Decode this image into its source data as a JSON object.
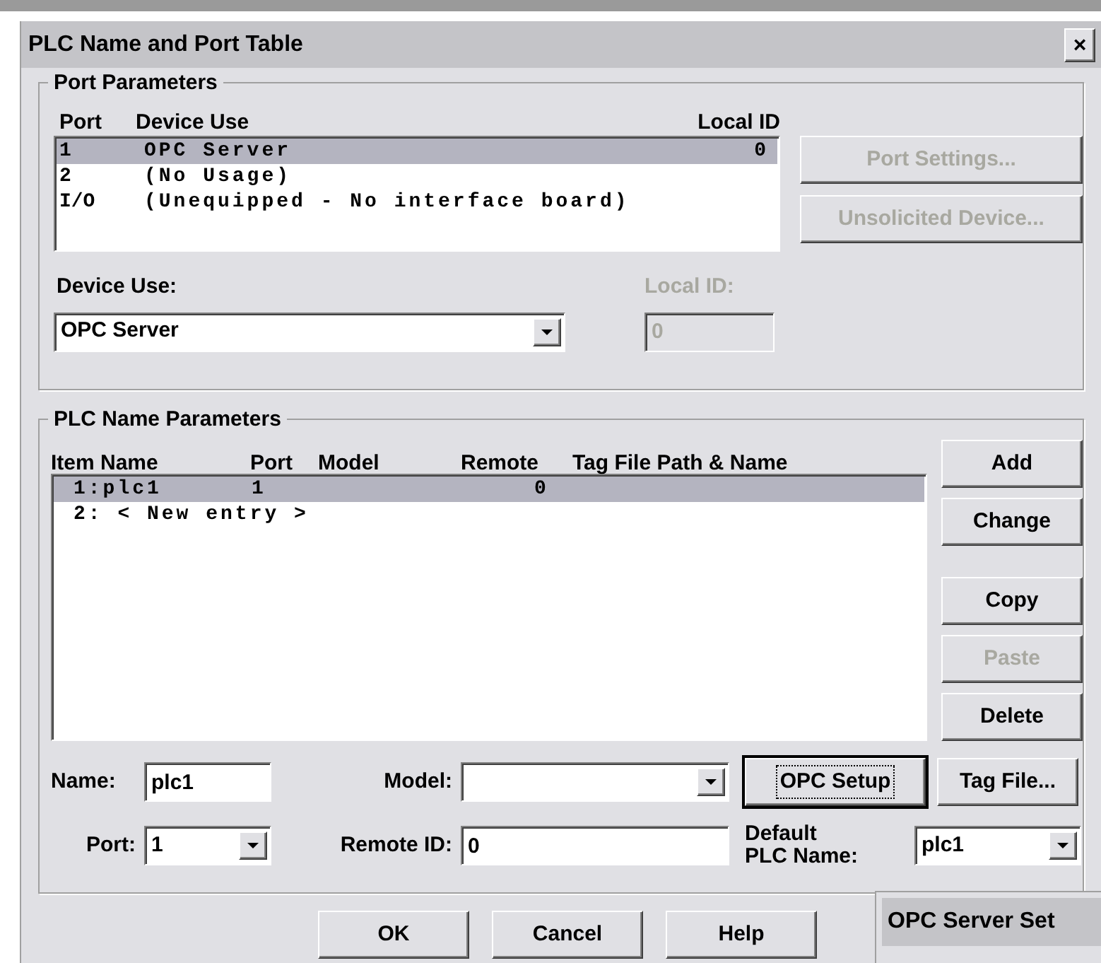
{
  "window": {
    "title": "PLC Name and Port Table",
    "close": "×"
  },
  "port_parameters": {
    "title": "Port Parameters",
    "columns": [
      "Port",
      "Device Use",
      "Local ID"
    ],
    "rows": [
      {
        "port": "1",
        "device_use": "OPC Server",
        "local_id": "0",
        "selected": true
      },
      {
        "port": "2",
        "device_use": "(No Usage)",
        "selected": false
      },
      {
        "port": "I/O",
        "device_use": "(Unequipped - No interface board)",
        "selected": false
      }
    ],
    "buttons": [
      {
        "label": "Port Settings...",
        "disabled": true
      },
      {
        "label": "Unsolicited Device...",
        "disabled": true
      }
    ],
    "device_use": {
      "label": "Device Use:",
      "value": "OPC Server"
    },
    "local_id": {
      "label": "Local ID:",
      "value": "0",
      "disabled": true
    }
  },
  "plc_name_parameters": {
    "title": "PLC Name Parameters",
    "columns": [
      "Item Name",
      "Port",
      "Model",
      "Remote",
      "Tag File Path & Name"
    ],
    "rows": [
      {
        "item_name": "1:plc1",
        "port": "1",
        "remote": "0",
        "selected": true
      },
      {
        "item_name": "2: < New entry >",
        "selected": false
      }
    ],
    "button_groups": [
      [
        {
          "label": "Add",
          "disabled": false
        },
        {
          "label": "Change",
          "disabled": false
        }
      ],
      [
        {
          "label": "Copy",
          "disabled": false
        },
        {
          "label": "Paste",
          "disabled": true
        },
        {
          "label": "Delete",
          "disabled": false
        }
      ]
    ],
    "name": {
      "label": "Name:",
      "value": "plc1"
    },
    "model": {
      "label": "Model:"
    },
    "opc_setup": {
      "label": "OPC Setup",
      "focused": true
    },
    "tag_file": {
      "label": "Tag File..."
    },
    "port": {
      "label": "Port:",
      "value": "1"
    },
    "remote_id": {
      "label": "Remote ID:",
      "value": "0"
    },
    "default_plc_name": {
      "label_lines": [
        "Default",
        "PLC Name:"
      ],
      "value": "plc1"
    }
  },
  "footer_buttons": [
    "OK",
    "Cancel",
    "Help"
  ],
  "background_window": {
    "title": "OPC Server Set"
  }
}
